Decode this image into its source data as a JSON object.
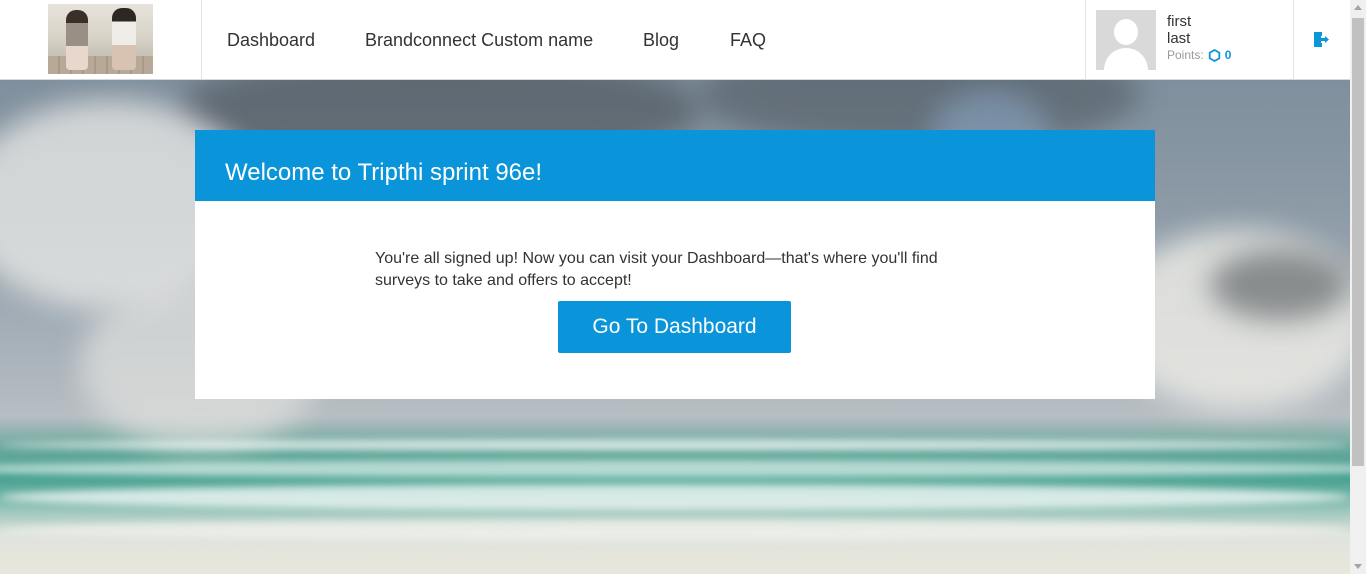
{
  "header": {
    "logo_alt": "two girls sitting on a deck",
    "nav": [
      {
        "label": "Dashboard"
      },
      {
        "label": "Brandconnect Custom name"
      },
      {
        "label": "Blog"
      },
      {
        "label": "FAQ"
      }
    ],
    "user": {
      "first_name": "first",
      "last_name": "last",
      "points_label": "Points:",
      "points_value": "0"
    },
    "logout_icon": "logout-icon"
  },
  "welcome": {
    "title": "Welcome to Tripthi sprint 96e!",
    "message": "You're all signed up! Now you can visit your Dashboard—that's where you'll find surveys to take and offers to accept!",
    "button_label": "Go To Dashboard"
  },
  "colors": {
    "accent": "#0a94d9",
    "text": "#333333",
    "muted": "#9a9a9a"
  }
}
